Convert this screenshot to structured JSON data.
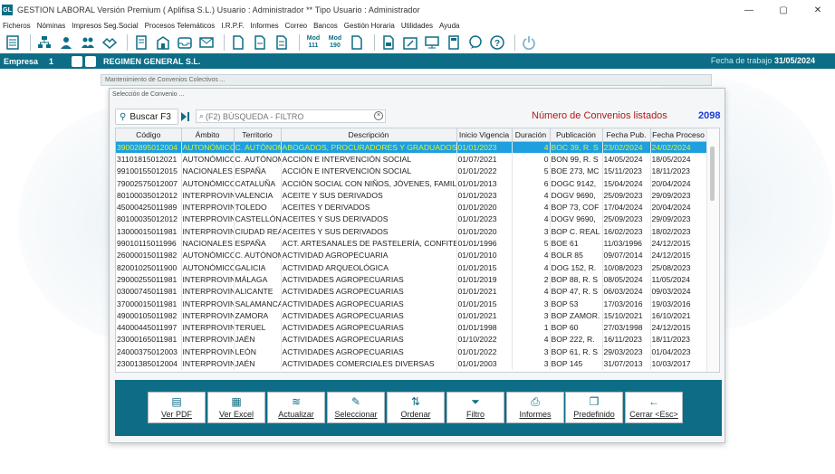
{
  "window": {
    "app_icon_text": "GL",
    "title": "GESTION LABORAL Versión Premium ( Aplifisa S.L.)   Usuario : Administrador  **  Tipo Usuario : Administrador",
    "minimize": "—",
    "maximize": "▢",
    "close": "✕"
  },
  "menu": [
    "Ficheros",
    "Nóminas",
    "Impresos Seg.Social",
    "Procesos Telemáticos",
    "I.R.P.F.",
    "Informes",
    "Correo",
    "Bancos",
    "Gestión Horaria",
    "Utilidades",
    "Ayuda"
  ],
  "toolbar": {
    "mod111": "Mod\n111",
    "mod190": "Mod\n190"
  },
  "empresa": {
    "label": "Empresa",
    "number": "1",
    "name": "REGIMEN GENERAL  S.L.",
    "fecha_label": "Fecha de trabajo",
    "fecha_value": "31/05/2024"
  },
  "background_window": {
    "title": "Mantenimiento de Convenios Colectivos ..."
  },
  "dialog": {
    "title": "Selección de Convenio ...",
    "buscar_label": "Buscar F3",
    "search_placeholder": "(F2) BÚSQUEDA - FILTRO",
    "count_label": "Número de Convenios listados",
    "count_value": "2098"
  },
  "grid": {
    "columns": [
      "Código",
      "Ámbito",
      "Territorio",
      "Descripción",
      "Inicio Vigencia",
      "Duración",
      "Publicación",
      "Fecha Pub.",
      "Fecha Proceso"
    ],
    "rows": [
      [
        "39002895012004",
        "AUTONÓMICO",
        "C. AUTÓNOMA",
        "ABOGADOS, PROCURADORES Y GRADUADOS",
        "01/01/2023",
        "4",
        "BOC 39, R. S",
        "23/02/2024",
        "24/02/2024"
      ],
      [
        "31101815012021",
        "AUTONÓMICO",
        "C. AUTÓNOMA",
        "ACCIÓN E INTERVENCIÓN SOCIAL",
        "01/07/2021",
        "0",
        "BON 99, R. S",
        "14/05/2024",
        "18/05/2024"
      ],
      [
        "99100155012015",
        "NACIONALES",
        "ESPAÑA",
        "ACCIÓN E INTERVENCIÓN SOCIAL",
        "01/01/2022",
        "5",
        "BOE 273, MC",
        "15/11/2023",
        "18/11/2023"
      ],
      [
        "79002575012007",
        "AUTONÓMICO",
        "CATALUÑA",
        "ACCIÓN SOCIAL CON NIÑOS, JÓVENES, FAMILIAS",
        "01/01/2013",
        "6",
        "DOGC 9142,",
        "15/04/2024",
        "20/04/2024"
      ],
      [
        "80100035012012",
        "INTERPROVINCIAL",
        "VALENCIA",
        "ACEITE Y SUS DERIVADOS",
        "01/01/2023",
        "4",
        "DOGV 9690,",
        "25/09/2023",
        "29/09/2023"
      ],
      [
        "45000425011989",
        "INTERPROVINCIAL",
        "TOLEDO",
        "ACEITES Y DERIVADOS",
        "01/01/2020",
        "4",
        "BOP 73, COF",
        "17/04/2024",
        "20/04/2024"
      ],
      [
        "80100035012012",
        "INTERPROVINCIAL",
        "CASTELLÓN",
        "ACEITES Y SUS DERIVADOS",
        "01/01/2023",
        "4",
        "DOGV 9690,",
        "25/09/2023",
        "29/09/2023"
      ],
      [
        "13000015011981",
        "INTERPROVINCIAL",
        "CIUDAD REAL",
        "ACEITES Y SUS DERIVADOS",
        "01/01/2020",
        "3",
        "BOP C. REAL",
        "16/02/2023",
        "18/02/2023"
      ],
      [
        "99010115011996",
        "NACIONALES",
        "ESPAÑA",
        "ACT. ARTESANALES DE PASTELERÍA, CONFITERÍA",
        "01/01/1996",
        "5",
        "BOE 61",
        "11/03/1996",
        "24/12/2015"
      ],
      [
        "26000015011982",
        "AUTONÓMICO",
        "C. AUTÓNOMA",
        "ACTIVIDAD AGROPECUARIA",
        "01/01/2010",
        "4",
        "BOLR 85",
        "09/07/2014",
        "24/12/2015"
      ],
      [
        "82001025011900",
        "AUTONÓMICO",
        "GALICIA",
        "ACTIVIDAD ARQUEOLÓGICA",
        "01/01/2015",
        "4",
        "DOG 152, R.",
        "10/08/2023",
        "25/08/2023"
      ],
      [
        "29000255011981",
        "INTERPROVINCIAL",
        "MÁLAGA",
        "ACTIVIDADES AGROPECUARIAS",
        "01/01/2019",
        "2",
        "BOP 88, R. S",
        "08/05/2024",
        "11/05/2024"
      ],
      [
        "03000745011981",
        "INTERPROVINCIAL",
        "ALICANTE",
        "ACTIVIDADES AGROPECUARIAS",
        "01/01/2021",
        "4",
        "BOP 47, R. S",
        "06/03/2024",
        "09/03/2024"
      ],
      [
        "37000015011981",
        "INTERPROVINCIAL",
        "SALAMANCA",
        "ACTIVIDADES AGROPECUARIAS",
        "01/01/2015",
        "3",
        "BOP 53",
        "17/03/2016",
        "19/03/2016"
      ],
      [
        "49000105011982",
        "INTERPROVINCIAL",
        "ZAMORA",
        "ACTIVIDADES AGROPECUARIAS",
        "01/01/2021",
        "3",
        "BOP ZAMOR.",
        "15/10/2021",
        "16/10/2021"
      ],
      [
        "44000445011997",
        "INTERPROVINCIAL",
        "TERUEL",
        "ACTIVIDADES AGROPECUARIAS",
        "01/01/1998",
        "1",
        "BOP 60",
        "27/03/1998",
        "24/12/2015"
      ],
      [
        "23000165011981",
        "INTERPROVINCIAL",
        "JAÉN",
        "ACTIVIDADES AGROPECUARIAS",
        "01/10/2022",
        "4",
        "BOP 222, R.",
        "16/11/2023",
        "18/11/2023"
      ],
      [
        "24000375012003",
        "INTERPROVINCIAL",
        "LEÓN",
        "ACTIVIDADES AGROPECUARIAS",
        "01/01/2022",
        "3",
        "BOP 61, R. S",
        "29/03/2023",
        "01/04/2023"
      ],
      [
        "23001385012004",
        "INTERPROVINCIAL",
        "JAÉN",
        "ACTIVIDADES COMERCIALES DIVERSAS",
        "01/01/2003",
        "3",
        "BOP 145",
        "31/07/2013",
        "10/03/2017"
      ]
    ]
  },
  "actions": [
    {
      "label": "Ver PDF",
      "icon": "file-pdf-icon",
      "glyph": "▤"
    },
    {
      "label": "Ver Excel",
      "icon": "file-excel-icon",
      "glyph": "▦"
    },
    {
      "label": "Actualizar",
      "icon": "database-icon",
      "glyph": "≋"
    },
    {
      "label": "Seleccionar",
      "icon": "edit-icon",
      "glyph": "✎"
    },
    {
      "label": "Ordenar",
      "icon": "sort-icon",
      "glyph": "⇅"
    },
    {
      "label": "Filtro",
      "icon": "filter-icon",
      "glyph": "⏷"
    },
    {
      "label": "Informes",
      "icon": "printer-icon",
      "glyph": "⎙"
    },
    {
      "label": "Predefinido",
      "icon": "copy-icon",
      "glyph": "❐"
    },
    {
      "label": "Cerrar <Esc>",
      "icon": "arrow-left-icon",
      "glyph": "←"
    }
  ],
  "colors": {
    "accent": "#0d6d86",
    "selected_row_bg": "#1e9fe0",
    "selected_row_text": "#d7f52e",
    "count_label": "#b11919",
    "count_value": "#1a3bd6"
  }
}
